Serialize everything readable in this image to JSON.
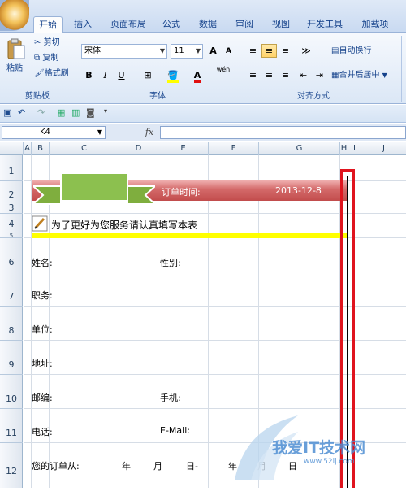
{
  "tabs": [
    "开始",
    "插入",
    "页面布局",
    "公式",
    "数据",
    "审阅",
    "视图",
    "开发工具",
    "加载项"
  ],
  "clipboard": {
    "paste": "粘贴",
    "cut": "剪切",
    "copy": "复制",
    "format_painter": "格式刷",
    "label": "剪贴板"
  },
  "font": {
    "name": "宋体",
    "size": "11",
    "grow": "A",
    "shrink": "A",
    "bold": "B",
    "italic": "I",
    "underline": "U",
    "font_color": "A",
    "phonetic": "wén",
    "label": "字体"
  },
  "alignment": {
    "wrap": "自动换行",
    "merge": "合并后居中",
    "label": "对齐方式"
  },
  "name_box": "K4",
  "fx": "fx",
  "columns": [
    "A",
    "B",
    "C",
    "D",
    "E",
    "F",
    "G",
    "H",
    "I",
    "J"
  ],
  "rows": [
    "1",
    "2",
    "3",
    "4",
    "5",
    "6",
    "7",
    "8",
    "9",
    "10",
    "11",
    "12"
  ],
  "sheet": {
    "order_time_label": "订单时间:",
    "order_date": "2013-12-8",
    "notice": "为了更好为您服务请认真填写本表",
    "name": "姓名:",
    "gender": "性别:",
    "position": "职务:",
    "company": "单位:",
    "address": "地址:",
    "zip": "邮编:",
    "mobile": "手机:",
    "phone": "电话:",
    "email": "E-Mail:",
    "order_from": "您的订单从:",
    "year": "年",
    "month": "月",
    "day_to": "日-",
    "year2": "年",
    "month2": "月",
    "day2": "日"
  },
  "watermark": {
    "text": "我爱IT技术网",
    "url": "www.52ij.com"
  },
  "colors": {
    "ribbon_band": "#c85a5a",
    "banner_green": "#86b84a",
    "highlight_yellow": "#ffff00",
    "selection_red": "#e0141e"
  }
}
